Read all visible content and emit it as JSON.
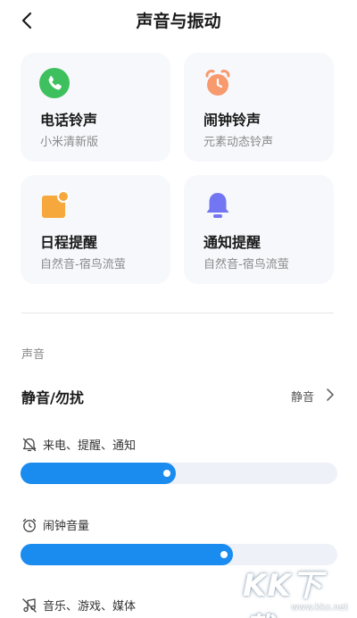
{
  "header": {
    "title": "声音与振动"
  },
  "cards": [
    {
      "title": "电话铃声",
      "subtitle": "小米清新版",
      "icon": "phone-icon",
      "color": "#3ec05e"
    },
    {
      "title": "闹钟铃声",
      "subtitle": "元素动态铃声",
      "icon": "alarm-clock-icon",
      "color": "#f79a6e"
    },
    {
      "title": "日程提醒",
      "subtitle": "自然音-宿鸟流萤",
      "icon": "calendar-icon",
      "color": "#f6a83c"
    },
    {
      "title": "通知提醒",
      "subtitle": "自然音-宿鸟流萤",
      "icon": "bell-icon",
      "color": "#7276f3"
    }
  ],
  "sound_section": {
    "label": "声音",
    "dnd": {
      "label": "静音/勿扰",
      "value": "静音"
    }
  },
  "volumes": [
    {
      "label": "来电、提醒、通知",
      "icon": "bell-muted-icon",
      "level": 0.49
    },
    {
      "label": "闹钟音量",
      "icon": "alarm-icon",
      "level": 0.67
    },
    {
      "label": "音乐、游戏、媒体",
      "icon": "music-muted-icon"
    }
  ],
  "watermark": {
    "text": "KK下载",
    "url": "www.kkx.net"
  },
  "accent_color": "#1a8cf0"
}
